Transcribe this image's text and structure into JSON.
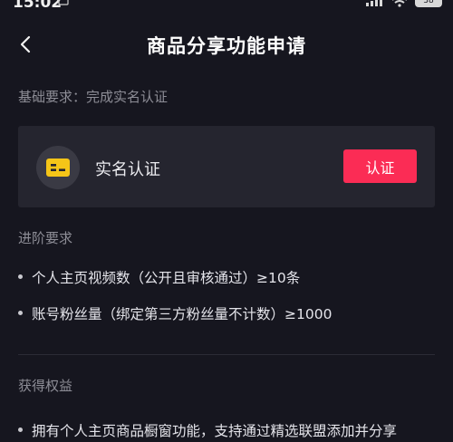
{
  "status_bar": {
    "time": "15:02",
    "battery": "38"
  },
  "nav": {
    "title": "商品分享功能申请"
  },
  "basic_requirement": {
    "label": "基础要求：完成实名认证",
    "card_label": "实名认证",
    "button_label": "认证"
  },
  "advanced": {
    "label": "进阶要求",
    "items": [
      "个人主页视频数（公开且审核通过）≥10条",
      "账号粉丝量（绑定第三方粉丝量不计数）≥1000"
    ]
  },
  "benefits": {
    "label": "获得权益",
    "items": [
      "拥有个人主页商品橱窗功能，支持通过精选联盟添加并分享"
    ]
  },
  "colors": {
    "background": "#16161f",
    "card": "#25252f",
    "accent": "#fb2c55",
    "id_icon": "#f5c518"
  },
  "icons": {
    "back": "chevron-left-icon",
    "id_card": "id-card-icon"
  }
}
